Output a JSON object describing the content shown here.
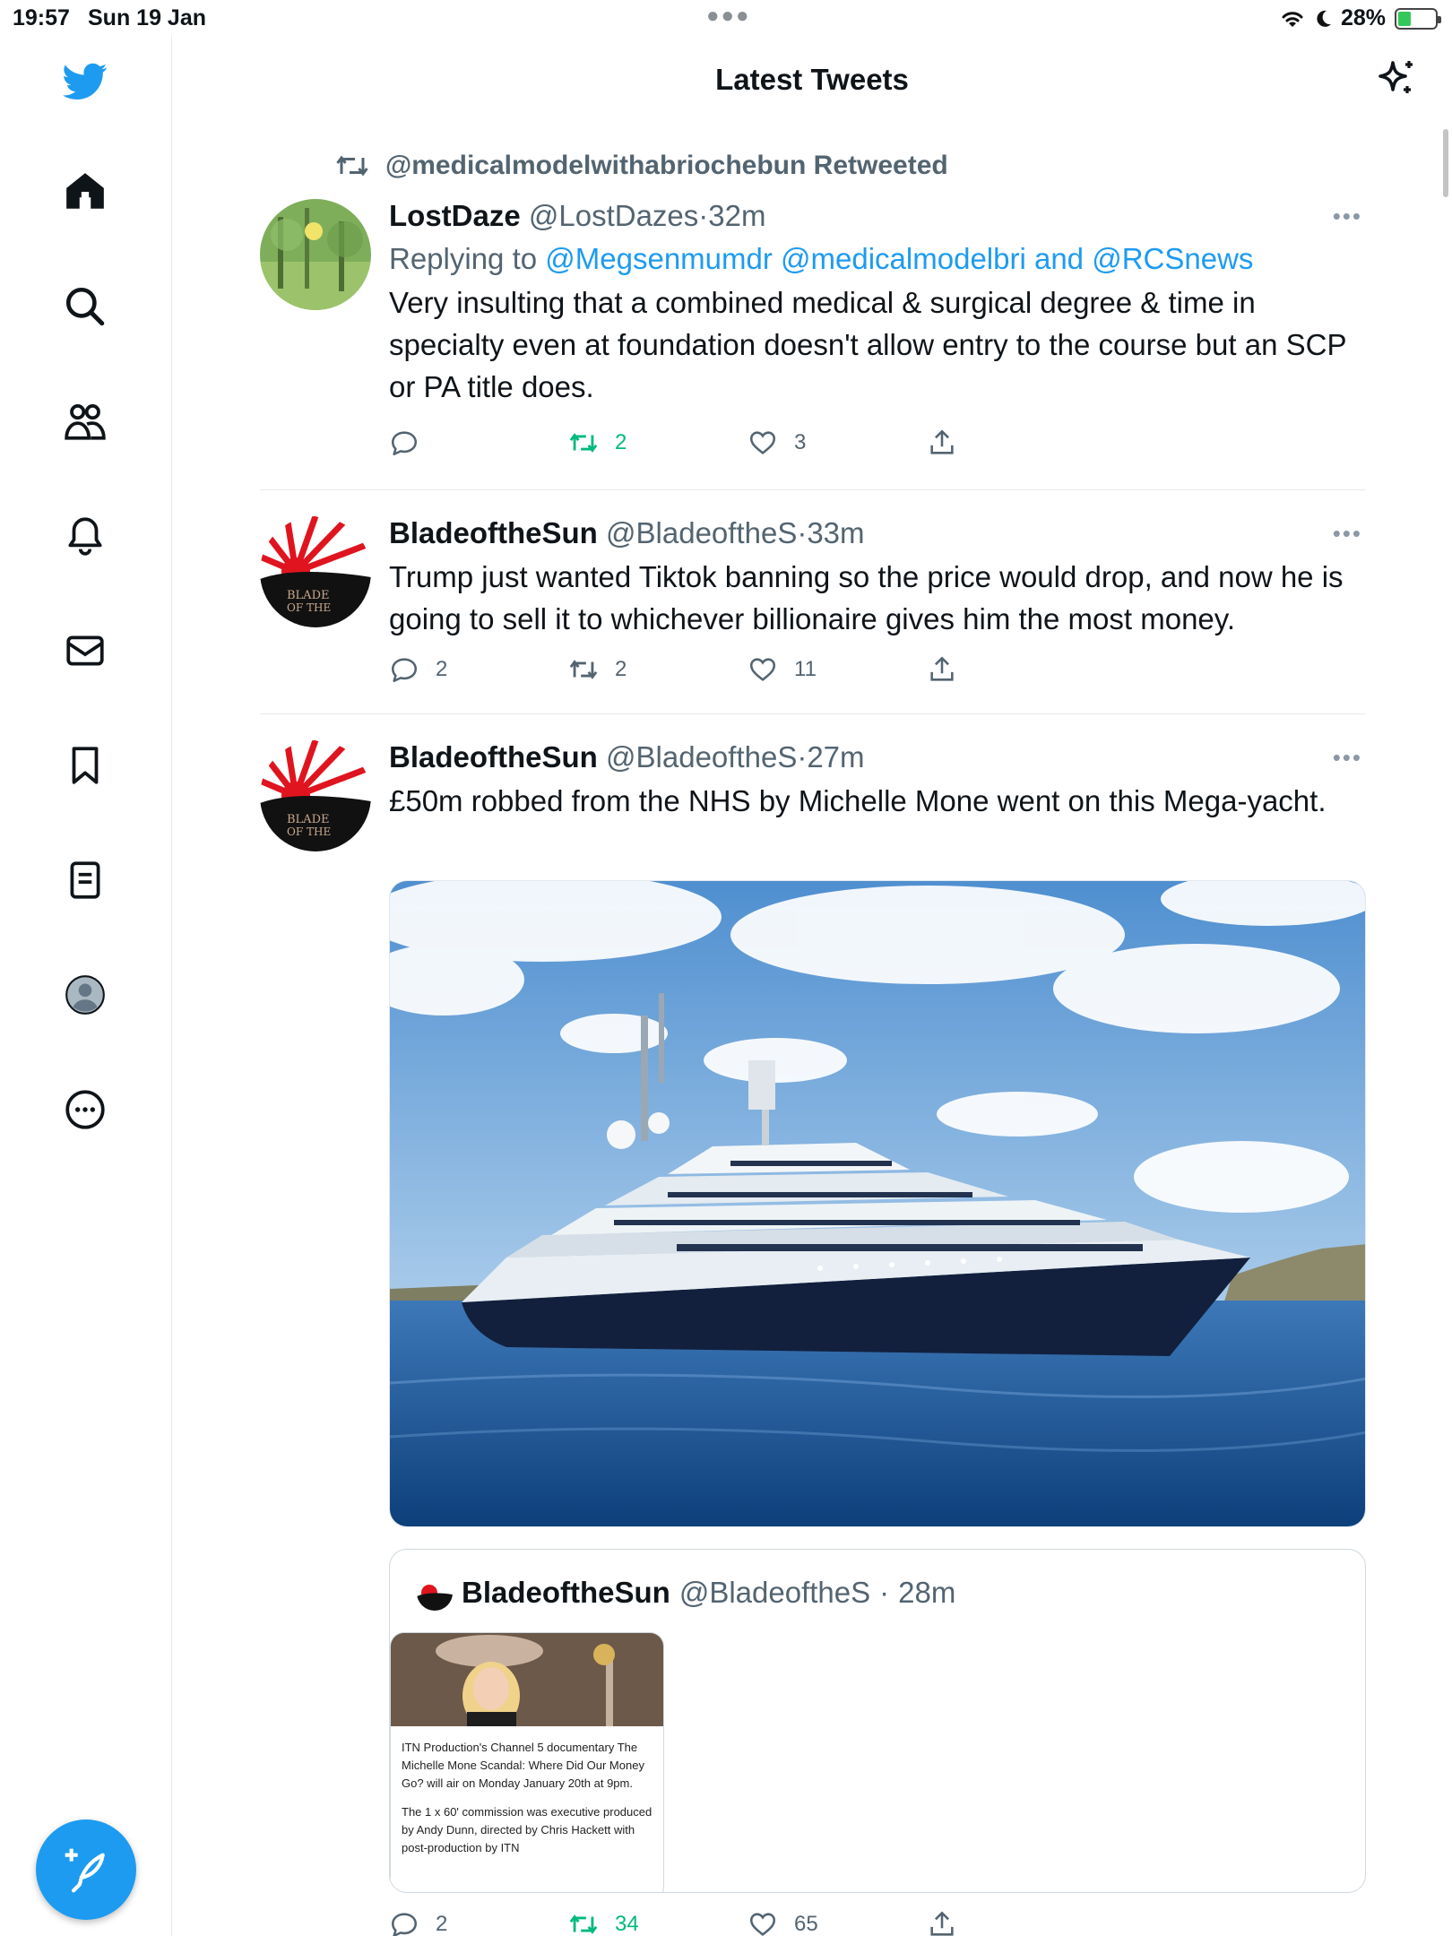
{
  "status": {
    "time": "19:57",
    "date": "Sun 19 Jan",
    "battery": "28%",
    "battery_level": 0.28
  },
  "header": {
    "title": "Latest Tweets"
  },
  "sidebar": {
    "items": [
      "twitter-logo",
      "home-icon",
      "search-icon",
      "communities-icon",
      "notifications-icon",
      "messages-icon",
      "bookmarks-icon",
      "lists-icon",
      "profile-icon",
      "more-icon"
    ],
    "compose_label": "compose"
  },
  "tweets": [
    {
      "retweeted_by": "@medicalmodelwithabriochebun Retweeted",
      "name": "LostDaze",
      "handle": "@LostDazes",
      "sep": "·",
      "age": "32m",
      "reply_prefix": "Replying to",
      "reply_user1": "@Megsenmumdr",
      "reply_user2": "@medicalmodelbri",
      "reply_and": "and",
      "reply_user3": "@RCSnews",
      "text": "Very insulting that a combined medical & surgical degree & time in specialty even at foundation doesn't allow entry to the course but an SCP or PA title does.",
      "replies": "",
      "retweets": "2",
      "likes": "3"
    },
    {
      "name": "BladeoftheSun",
      "handle": "@BladeoftheS",
      "sep": "·",
      "age": "33m",
      "text": "Trump just wanted Tiktok banning so the price would drop, and now he is going to sell it to whichever billionaire gives him the most money.",
      "replies": "2",
      "retweets": "2",
      "likes": "11"
    },
    {
      "name": "BladeoftheSun",
      "handle": "@BladeoftheS",
      "sep": "·",
      "age": "27m",
      "text": "£50m robbed from the NHS by Michelle Mone went on this Mega-yacht.",
      "replies": "2",
      "retweets": "34",
      "likes": "65",
      "quote": {
        "name": "BladeoftheSun",
        "handle": "@BladeoftheS",
        "sep": "·",
        "age": "28m",
        "card_p1": "ITN Production's Channel 5 documentary The Michelle Mone Scandal: Where Did Our Money Go? will air on Monday January 20th at 9pm.",
        "card_p2": "The 1 x 60' commission was executive produced by Andy Dunn, directed by Chris Hackett with post-production by ITN"
      }
    }
  ],
  "colors": {
    "accent": "#1d9bf0",
    "retweet_green": "#00ba7c",
    "muted": "#536471"
  }
}
